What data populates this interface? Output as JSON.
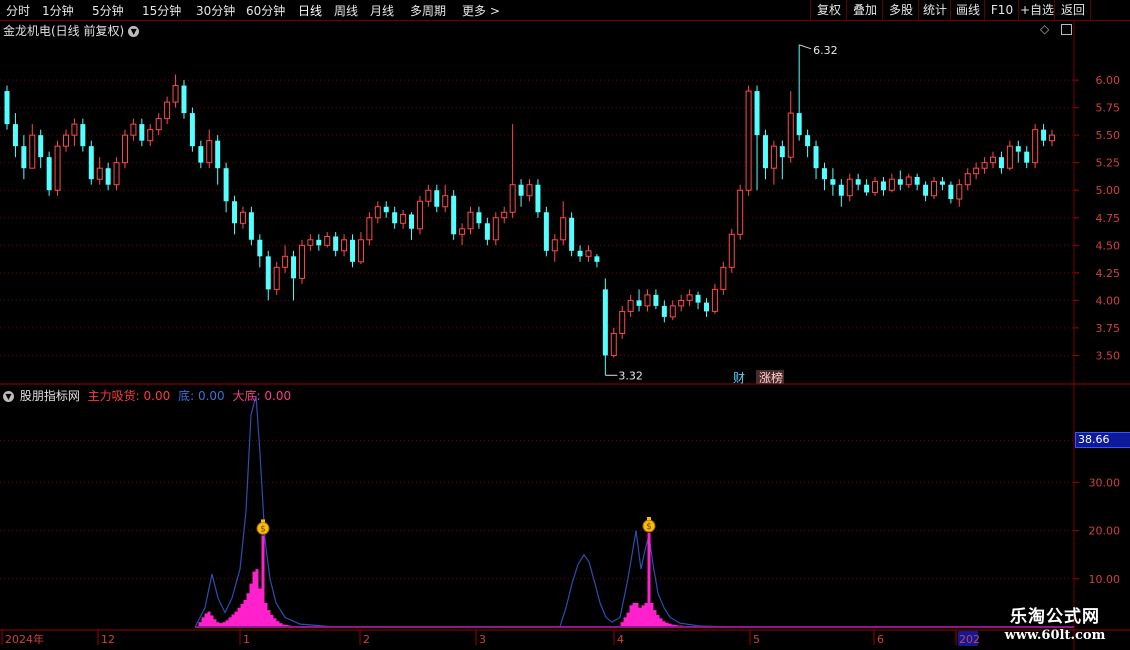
{
  "toolbar": {
    "periods": [
      "分时",
      "1分钟",
      "5分钟",
      "15分钟",
      "30分钟",
      "60分钟",
      "日线",
      "周线",
      "月线",
      "多周期",
      "更多 >"
    ],
    "active_period": "日线",
    "right_buttons": [
      "复权",
      "叠加",
      "多股",
      "统计",
      "画线",
      "F10",
      "+自选",
      "返回"
    ]
  },
  "main_chart": {
    "title": "金龙机电(日线 前复权)",
    "high_label": "6.32",
    "low_label": "3.32",
    "badge_cai": "财",
    "badge_zhangbang": "涨榜",
    "y_ticks": [
      "6.00",
      "5.75",
      "5.50",
      "5.25",
      "5.00",
      "4.75",
      "4.50",
      "4.25",
      "4.00",
      "3.75",
      "3.50"
    ]
  },
  "indicator": {
    "name": "股朋指标网",
    "s1_label": "主力吸货:",
    "s1_value": "0.00",
    "s2_label": "底:",
    "s2_value": "0.00",
    "s3_label": "大底:",
    "s3_value": "0.00",
    "current_value": "38.66",
    "y_ticks": [
      "30.00",
      "20.00",
      "10.00"
    ]
  },
  "x_axis": {
    "labels": [
      "2024年",
      "12",
      "1",
      "2",
      "3",
      "4",
      "5",
      "6",
      "202"
    ]
  },
  "watermark": {
    "cn": "乐淘公式网",
    "url": "www.60lt.com"
  },
  "colors": {
    "up": "#ff4a4a",
    "down": "#54ffff",
    "grid": "#7a0000",
    "indicator_bar": "#ff22cc",
    "indicator_line": "#2a4fb0",
    "s1_color": "#ff3b3b",
    "s2_color": "#3f6fd8",
    "s3_color": "#ff3b8a"
  },
  "chart_data": {
    "type": "candlestick",
    "price_range": [
      3.25,
      6.4
    ],
    "candles": [
      [
        5.9,
        5.6,
        5.95,
        5.55
      ],
      [
        5.6,
        5.4,
        5.7,
        5.3
      ],
      [
        5.4,
        5.2,
        5.5,
        5.1
      ],
      [
        5.2,
        5.5,
        5.6,
        5.2
      ],
      [
        5.5,
        5.3,
        5.55,
        5.2
      ],
      [
        5.3,
        5.0,
        5.35,
        4.95
      ],
      [
        5.0,
        5.4,
        5.45,
        4.95
      ],
      [
        5.4,
        5.5,
        5.55,
        5.35
      ],
      [
        5.5,
        5.6,
        5.65,
        5.4
      ],
      [
        5.6,
        5.4,
        5.65,
        5.35
      ],
      [
        5.4,
        5.1,
        5.45,
        5.05
      ],
      [
        5.1,
        5.2,
        5.3,
        5.05
      ],
      [
        5.2,
        5.05,
        5.25,
        5.0
      ],
      [
        5.05,
        5.25,
        5.3,
        5.0
      ],
      [
        5.25,
        5.5,
        5.55,
        5.2
      ],
      [
        5.5,
        5.6,
        5.65,
        5.45
      ],
      [
        5.6,
        5.45,
        5.65,
        5.4
      ],
      [
        5.45,
        5.55,
        5.6,
        5.4
      ],
      [
        5.55,
        5.65,
        5.7,
        5.5
      ],
      [
        5.65,
        5.8,
        5.85,
        5.6
      ],
      [
        5.8,
        5.95,
        6.05,
        5.75
      ],
      [
        5.95,
        5.7,
        6.0,
        5.65
      ],
      [
        5.7,
        5.4,
        5.75,
        5.35
      ],
      [
        5.4,
        5.25,
        5.45,
        5.2
      ],
      [
        5.25,
        5.45,
        5.55,
        5.2
      ],
      [
        5.45,
        5.2,
        5.5,
        5.05
      ],
      [
        5.2,
        4.9,
        5.25,
        4.8
      ],
      [
        4.9,
        4.7,
        4.95,
        4.6
      ],
      [
        4.7,
        4.8,
        4.85,
        4.65
      ],
      [
        4.8,
        4.55,
        4.85,
        4.5
      ],
      [
        4.55,
        4.4,
        4.6,
        4.3
      ],
      [
        4.4,
        4.1,
        4.45,
        4.0
      ],
      [
        4.1,
        4.3,
        4.35,
        4.05
      ],
      [
        4.3,
        4.4,
        4.5,
        4.25
      ],
      [
        4.4,
        4.2,
        4.45,
        4.0
      ],
      [
        4.2,
        4.5,
        4.55,
        4.15
      ],
      [
        4.5,
        4.55,
        4.6,
        4.45
      ],
      [
        4.55,
        4.5,
        4.6,
        4.45
      ],
      [
        4.5,
        4.58,
        4.62,
        4.48
      ],
      [
        4.58,
        4.45,
        4.62,
        4.4
      ],
      [
        4.45,
        4.55,
        4.6,
        4.4
      ],
      [
        4.55,
        4.35,
        4.6,
        4.3
      ],
      [
        4.35,
        4.55,
        4.62,
        4.33
      ],
      [
        4.55,
        4.75,
        4.8,
        4.5
      ],
      [
        4.75,
        4.85,
        4.9,
        4.7
      ],
      [
        4.85,
        4.8,
        4.9,
        4.75
      ],
      [
        4.8,
        4.7,
        4.85,
        4.65
      ],
      [
        4.7,
        4.78,
        4.82,
        4.65
      ],
      [
        4.78,
        4.65,
        4.8,
        4.55
      ],
      [
        4.65,
        4.9,
        4.95,
        4.6
      ],
      [
        4.9,
        5.0,
        5.05,
        4.85
      ],
      [
        5.0,
        4.85,
        5.05,
        4.8
      ],
      [
        4.85,
        4.95,
        5.05,
        4.8
      ],
      [
        4.95,
        4.6,
        5.0,
        4.55
      ],
      [
        4.6,
        4.65,
        4.7,
        4.5
      ],
      [
        4.65,
        4.8,
        4.85,
        4.6
      ],
      [
        4.8,
        4.7,
        4.85,
        4.65
      ],
      [
        4.7,
        4.55,
        4.75,
        4.5
      ],
      [
        4.55,
        4.75,
        4.8,
        4.5
      ],
      [
        4.75,
        4.8,
        4.85,
        4.7
      ],
      [
        4.8,
        5.05,
        5.6,
        4.75
      ],
      [
        5.05,
        4.95,
        5.1,
        4.85
      ],
      [
        4.95,
        5.05,
        5.1,
        4.9
      ],
      [
        5.05,
        4.8,
        5.1,
        4.75
      ],
      [
        4.8,
        4.45,
        4.85,
        4.4
      ],
      [
        4.45,
        4.55,
        4.6,
        4.35
      ],
      [
        4.55,
        4.75,
        4.9,
        4.5
      ],
      [
        4.75,
        4.45,
        4.8,
        4.4
      ],
      [
        4.45,
        4.4,
        4.5,
        4.35
      ],
      [
        4.4,
        4.45,
        4.5,
        4.35
      ],
      [
        4.4,
        4.35,
        4.42,
        4.3
      ],
      [
        4.1,
        3.5,
        4.2,
        3.32
      ],
      [
        3.5,
        3.7,
        3.75,
        3.48
      ],
      [
        3.7,
        3.9,
        3.95,
        3.65
      ],
      [
        3.9,
        4.0,
        4.05,
        3.85
      ],
      [
        4.0,
        3.95,
        4.1,
        3.9
      ],
      [
        3.95,
        4.05,
        4.1,
        3.9
      ],
      [
        4.05,
        3.95,
        4.1,
        3.92
      ],
      [
        3.95,
        3.85,
        4.0,
        3.8
      ],
      [
        3.85,
        3.95,
        4.0,
        3.82
      ],
      [
        3.95,
        4.0,
        4.05,
        3.9
      ],
      [
        4.0,
        4.05,
        4.1,
        3.95
      ],
      [
        4.05,
        3.98,
        4.08,
        3.92
      ],
      [
        3.98,
        3.9,
        4.02,
        3.85
      ],
      [
        3.9,
        4.1,
        4.15,
        3.88
      ],
      [
        4.1,
        4.3,
        4.35,
        4.05
      ],
      [
        4.3,
        4.6,
        4.65,
        4.25
      ],
      [
        4.6,
        5.0,
        5.05,
        4.55
      ],
      [
        5.0,
        5.9,
        5.95,
        4.95
      ],
      [
        5.9,
        5.5,
        5.95,
        5.0
      ],
      [
        5.5,
        5.2,
        5.55,
        5.1
      ],
      [
        5.2,
        5.4,
        5.45,
        5.05
      ],
      [
        5.4,
        5.3,
        5.45,
        5.1
      ],
      [
        5.3,
        5.7,
        5.9,
        5.25
      ],
      [
        5.7,
        5.5,
        6.32,
        5.45
      ],
      [
        5.5,
        5.4,
        5.55,
        5.3
      ],
      [
        5.4,
        5.2,
        5.45,
        5.1
      ],
      [
        5.2,
        5.1,
        5.25,
        5.0
      ],
      [
        5.1,
        5.05,
        5.2,
        4.95
      ],
      [
        5.05,
        4.95,
        5.1,
        4.85
      ],
      [
        4.95,
        5.1,
        5.15,
        4.9
      ],
      [
        5.1,
        5.05,
        5.15,
        5.0
      ],
      [
        5.05,
        4.98,
        5.1,
        4.95
      ],
      [
        4.98,
        5.08,
        5.12,
        4.95
      ],
      [
        5.08,
        5.0,
        5.12,
        4.95
      ],
      [
        5.0,
        5.1,
        5.15,
        4.98
      ],
      [
        5.1,
        5.05,
        5.18,
        5.0
      ],
      [
        5.05,
        5.12,
        5.15,
        5.02
      ],
      [
        5.12,
        5.05,
        5.15,
        5.0
      ],
      [
        5.05,
        4.95,
        5.08,
        4.9
      ],
      [
        4.95,
        5.08,
        5.12,
        4.92
      ],
      [
        5.08,
        5.05,
        5.12,
        5.0
      ],
      [
        5.05,
        4.92,
        5.08,
        4.88
      ],
      [
        4.92,
        5.05,
        5.1,
        4.85
      ],
      [
        5.05,
        5.15,
        5.2,
        5.0
      ],
      [
        5.15,
        5.2,
        5.25,
        5.1
      ],
      [
        5.2,
        5.25,
        5.3,
        5.15
      ],
      [
        5.25,
        5.3,
        5.35,
        5.2
      ],
      [
        5.3,
        5.2,
        5.35,
        5.15
      ],
      [
        5.2,
        5.4,
        5.45,
        5.18
      ],
      [
        5.4,
        5.35,
        5.45,
        5.25
      ],
      [
        5.35,
        5.25,
        5.4,
        5.2
      ],
      [
        5.25,
        5.55,
        5.6,
        5.2
      ],
      [
        5.55,
        5.45,
        5.6,
        5.4
      ],
      [
        5.45,
        5.5,
        5.55,
        5.4
      ]
    ],
    "indicator_range": [
      0,
      50
    ],
    "indicator_bars": [
      {
        "x": 200,
        "v": 1.0
      },
      {
        "x": 203,
        "v": 2.0
      },
      {
        "x": 206,
        "v": 2.8
      },
      {
        "x": 209,
        "v": 3.2
      },
      {
        "x": 212,
        "v": 2.4
      },
      {
        "x": 215,
        "v": 1.6
      },
      {
        "x": 218,
        "v": 1.0
      },
      {
        "x": 221,
        "v": 0.8
      },
      {
        "x": 224,
        "v": 1.0
      },
      {
        "x": 227,
        "v": 1.4
      },
      {
        "x": 230,
        "v": 2.0
      },
      {
        "x": 233,
        "v": 2.6
      },
      {
        "x": 236,
        "v": 3.2
      },
      {
        "x": 239,
        "v": 4.0
      },
      {
        "x": 242,
        "v": 4.8
      },
      {
        "x": 245,
        "v": 5.6
      },
      {
        "x": 248,
        "v": 7.0
      },
      {
        "x": 251,
        "v": 9.0
      },
      {
        "x": 254,
        "v": 11.5
      },
      {
        "x": 257,
        "v": 12.0
      },
      {
        "x": 260,
        "v": 8.0
      },
      {
        "x": 263,
        "v": 19.0
      },
      {
        "x": 266,
        "v": 5.0
      },
      {
        "x": 269,
        "v": 3.5
      },
      {
        "x": 272,
        "v": 2.5
      },
      {
        "x": 275,
        "v": 1.8
      },
      {
        "x": 278,
        "v": 1.2
      },
      {
        "x": 281,
        "v": 0.8
      },
      {
        "x": 284,
        "v": 0.5
      },
      {
        "x": 287,
        "v": 0.4
      },
      {
        "x": 290,
        "v": 0.3
      },
      {
        "x": 293,
        "v": 0.2
      },
      {
        "x": 296,
        "v": 0.2
      },
      {
        "x": 299,
        "v": 0.1
      },
      {
        "x": 622,
        "v": 1.0
      },
      {
        "x": 625,
        "v": 2.0
      },
      {
        "x": 628,
        "v": 3.0
      },
      {
        "x": 631,
        "v": 4.5
      },
      {
        "x": 634,
        "v": 5.0
      },
      {
        "x": 637,
        "v": 5.0
      },
      {
        "x": 640,
        "v": 4.0
      },
      {
        "x": 643,
        "v": 4.5
      },
      {
        "x": 646,
        "v": 5.0
      },
      {
        "x": 649,
        "v": 19.5
      },
      {
        "x": 652,
        "v": 5.0
      },
      {
        "x": 655,
        "v": 3.5
      },
      {
        "x": 658,
        "v": 2.5
      },
      {
        "x": 661,
        "v": 1.8
      },
      {
        "x": 664,
        "v": 1.2
      },
      {
        "x": 667,
        "v": 0.9
      },
      {
        "x": 670,
        "v": 0.7
      },
      {
        "x": 673,
        "v": 0.5
      },
      {
        "x": 676,
        "v": 0.4
      },
      {
        "x": 679,
        "v": 0.3
      },
      {
        "x": 682,
        "v": 0.3
      },
      {
        "x": 685,
        "v": 0.2
      },
      {
        "x": 688,
        "v": 0.2
      },
      {
        "x": 691,
        "v": 0.1
      },
      {
        "x": 694,
        "v": 0.1
      }
    ],
    "indicator_line": [
      [
        195,
        0
      ],
      [
        205,
        4
      ],
      [
        212,
        11
      ],
      [
        218,
        6
      ],
      [
        225,
        3
      ],
      [
        232,
        6
      ],
      [
        240,
        12
      ],
      [
        246,
        24
      ],
      [
        251,
        44
      ],
      [
        256,
        48
      ],
      [
        260,
        36
      ],
      [
        265,
        18
      ],
      [
        270,
        10
      ],
      [
        276,
        5
      ],
      [
        285,
        2
      ],
      [
        300,
        0.6
      ],
      [
        330,
        0.1
      ],
      [
        560,
        0.1
      ],
      [
        566,
        4
      ],
      [
        572,
        9
      ],
      [
        578,
        13
      ],
      [
        584,
        15
      ],
      [
        589,
        13.5
      ],
      [
        595,
        9
      ],
      [
        600,
        5
      ],
      [
        606,
        2
      ],
      [
        612,
        1
      ],
      [
        620,
        2
      ],
      [
        627,
        9
      ],
      [
        632,
        15
      ],
      [
        636,
        20
      ],
      [
        641,
        12
      ],
      [
        645,
        16
      ],
      [
        649,
        19
      ],
      [
        653,
        13
      ],
      [
        658,
        7
      ],
      [
        664,
        4
      ],
      [
        670,
        2
      ],
      [
        680,
        0.8
      ],
      [
        700,
        0.2
      ],
      [
        730,
        0.05
      ],
      [
        1070,
        0
      ]
    ],
    "signal_markers_x": [
      263,
      649
    ]
  }
}
